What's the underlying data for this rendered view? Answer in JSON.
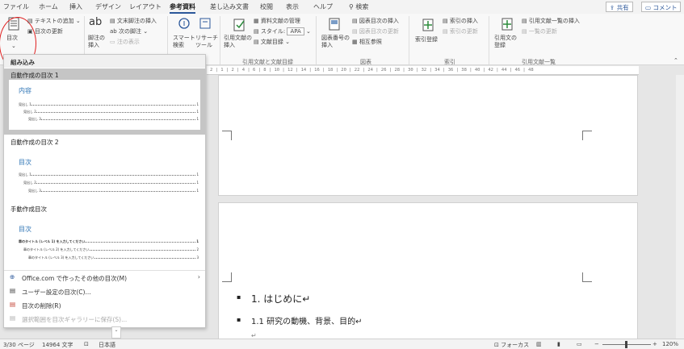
{
  "tabs": [
    "ファイル",
    "ホーム",
    "挿入",
    "デザイン",
    "レイアウト",
    "参考資料",
    "差し込み文書",
    "校閲",
    "表示",
    "ヘルプ"
  ],
  "active_tab": "参考資料",
  "search_label": "検索",
  "share_label": "共有",
  "comment_label": "コメント",
  "ribbon": {
    "toc_button": "目次",
    "toc_add_text": "テキストの追加",
    "toc_update": "目次の更新",
    "footnote_insert": "脚注の\n挿入",
    "endnote_insert": "文末脚注の挿入",
    "next_footnote": "次の脚注",
    "show_notes": "注の表示",
    "smart_lookup": "スマート\n検索",
    "researcher": "リサーチ\nツール",
    "insert_citation": "引用文献の\n挿入",
    "manage_sources": "資料文献の管理",
    "style_label": "スタイル:",
    "style_value": "APA",
    "bibliography": "文献目録",
    "insert_caption": "図表番号の\n挿入",
    "insert_table_of_figures": "図表目次の挿入",
    "update_table": "図表目次の更新",
    "cross_reference": "相互参照",
    "mark_entry": "索引登録",
    "insert_index": "索引の挿入",
    "update_index": "索引の更新",
    "mark_citation": "引用文の\n登録",
    "insert_toa": "引用文献一覧の挿入",
    "update_toa": "一覧の更新",
    "group_citations": "引用文献と文献目録",
    "group_captions": "図表",
    "group_index": "索引",
    "group_toa": "引用文献一覧"
  },
  "ruler_text": "2 | 1 | 2 | 4 | 6 | 8 | 10 | 12 | 14 | 16 | 18 | 20 | 22 | 24 | 26 | 28 | 30 | 32 | 34 | 36 | 38 | 40 | 42 | 44 | 46 | 48",
  "dropdown": {
    "header": "組み込み",
    "item1": {
      "title": "自動作成の目次 1",
      "heading": "内容",
      "lines": [
        {
          "label": "見出し 1",
          "num": "1"
        },
        {
          "label": "見出し 2",
          "num": "1"
        },
        {
          "label": "見出し 3",
          "num": "1"
        }
      ]
    },
    "item2": {
      "title": "自動作成の目次 2",
      "heading": "目次",
      "lines": [
        {
          "label": "見出し 1",
          "num": "1"
        },
        {
          "label": "見出し 2",
          "num": "1"
        },
        {
          "label": "見出し 3",
          "num": "1"
        }
      ]
    },
    "item3": {
      "title": "手動作成目次",
      "heading": "目次",
      "lines": [
        {
          "label": "章のタイトル (レベル 1) を入力してください",
          "num": "1"
        },
        {
          "label": "章のタイトル (レベル 2) を入力してください",
          "num": "2"
        },
        {
          "label": "章のタイトル (レベル 3) を入力してください",
          "num": "3"
        }
      ]
    },
    "office_more": "Office.com で作ったその他の目次(M)",
    "custom_toc": "ユーザー設定の目次(C)...",
    "remove_toc": "目次の削除(R)",
    "save_selection": "選択範囲を目次ギャラリーに保存(S)..."
  },
  "document": {
    "heading": "1.  はじめに↵",
    "bullet": "1.1 研究の動機、背景、目的↵",
    "para_mark": "↵"
  },
  "status": {
    "page": "3/30 ページ",
    "words": "14964 文字",
    "language": "日本語",
    "focus": "フォーカス",
    "zoom": "120%"
  },
  "colors": {
    "accent": "#2b579a",
    "selection": "#c5c5c5",
    "circle": "#e02020",
    "toc_heading": "#2e74b5"
  }
}
